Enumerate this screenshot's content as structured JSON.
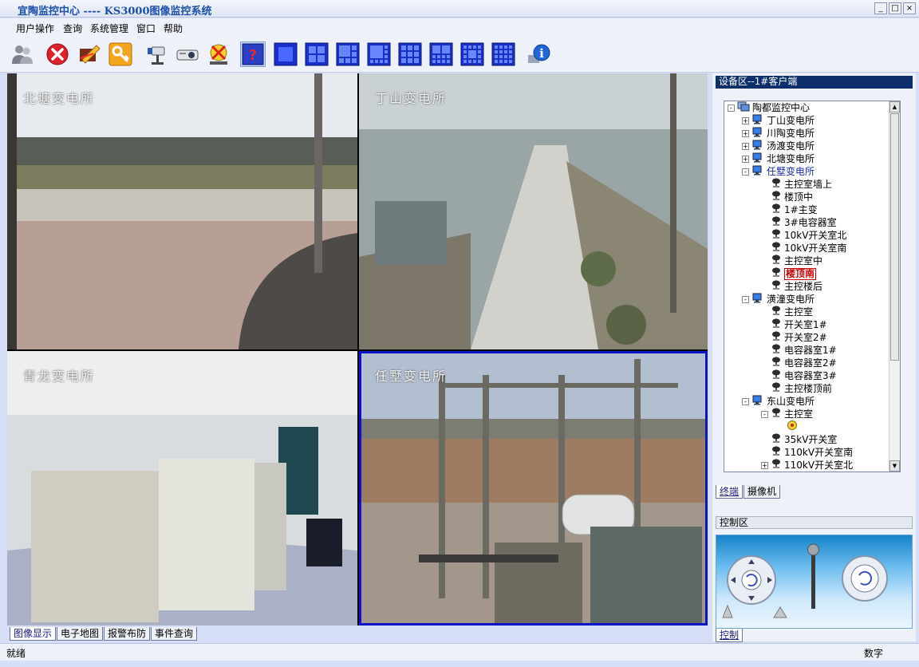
{
  "window": {
    "title": "宜陶监控中心 ---- KS3000图像监控系统",
    "btn_min": "_",
    "btn_max": "□",
    "btn_close": "×"
  },
  "menu": [
    "用户操作",
    "查询",
    "系统管理",
    "窗口",
    "帮助"
  ],
  "toolbar": {
    "icons": [
      "users-icon",
      "close-red-icon",
      "edit-icon",
      "key-icon",
      "camera-icon",
      "projector-icon",
      "disable-icon",
      "help-icon",
      "layout-1-icon",
      "layout-4-icon",
      "layout-6-icon",
      "layout-8-icon",
      "layout-9-icon",
      "layout-10-icon",
      "layout-13-icon",
      "layout-16-icon",
      "info-icon"
    ],
    "active_icon": "help-icon"
  },
  "video": {
    "panes": [
      {
        "label": "北塘变电所",
        "selected": false
      },
      {
        "label": "丁山变电所",
        "selected": false
      },
      {
        "label": "青龙变电所",
        "selected": false
      },
      {
        "label": "任墅变电所",
        "selected": true
      }
    ],
    "selected_border": "#0b15c7"
  },
  "bottom_tabs": [
    {
      "label": "图像显示",
      "active": true
    },
    {
      "label": "电子地图",
      "active": false
    },
    {
      "label": "报警布防",
      "active": false
    },
    {
      "label": "事件查询",
      "active": false
    }
  ],
  "status": {
    "left": "就绪",
    "right": "数字"
  },
  "device_panel": {
    "header": "设备区--1#客户端",
    "tree": [
      {
        "label": "陶都监控中心",
        "level": 0,
        "toggle": "-",
        "icon": "root"
      },
      {
        "label": "丁山变电所",
        "level": 1,
        "toggle": "+",
        "icon": "station"
      },
      {
        "label": "川陶变电所",
        "level": 1,
        "toggle": "+",
        "icon": "station"
      },
      {
        "label": "汤渡变电所",
        "level": 1,
        "toggle": "+",
        "icon": "station"
      },
      {
        "label": "北塘变电所",
        "level": 1,
        "toggle": "+",
        "icon": "station"
      },
      {
        "label": "任墅变电所",
        "level": 1,
        "toggle": "-",
        "icon": "station",
        "blue": true
      },
      {
        "label": "主控室墙上",
        "level": 2,
        "icon": "cam"
      },
      {
        "label": "楼顶中",
        "level": 2,
        "icon": "cam"
      },
      {
        "label": "1#主变",
        "level": 2,
        "icon": "cam"
      },
      {
        "label": "3#电容器室",
        "level": 2,
        "icon": "cam"
      },
      {
        "label": "10kV开关室北",
        "level": 2,
        "icon": "cam"
      },
      {
        "label": "10kV开关室南",
        "level": 2,
        "icon": "cam"
      },
      {
        "label": "主控室中",
        "level": 2,
        "icon": "cam"
      },
      {
        "label": "楼顶南",
        "level": 2,
        "icon": "cam",
        "highlight": true
      },
      {
        "label": "主控楼后",
        "level": 2,
        "icon": "cam"
      },
      {
        "label": "潢潼变电所",
        "level": 1,
        "toggle": "-",
        "icon": "station"
      },
      {
        "label": "主控室",
        "level": 2,
        "icon": "cam"
      },
      {
        "label": "开关室1#",
        "level": 2,
        "icon": "cam"
      },
      {
        "label": "开关室2#",
        "level": 2,
        "icon": "cam"
      },
      {
        "label": "电容器室1#",
        "level": 2,
        "icon": "cam"
      },
      {
        "label": "电容器室2#",
        "level": 2,
        "icon": "cam"
      },
      {
        "label": "电容器室3#",
        "level": 2,
        "icon": "cam"
      },
      {
        "label": "主控楼顶前",
        "level": 2,
        "icon": "cam"
      },
      {
        "label": "东山变电所",
        "level": 1,
        "toggle": "-",
        "icon": "station"
      },
      {
        "label": "主控室",
        "level": 2,
        "toggle": "-",
        "icon": "cam"
      },
      {
        "label": "",
        "level": 3,
        "icon": "alarm"
      },
      {
        "label": "35kV开关室",
        "level": 2,
        "icon": "cam"
      },
      {
        "label": "110kV开关室南",
        "level": 2,
        "icon": "cam"
      },
      {
        "label": "110kV开关室北",
        "level": 2,
        "toggle": "+",
        "icon": "cam"
      }
    ],
    "tabs": [
      {
        "label": "终端",
        "active": true
      },
      {
        "label": "摄像机",
        "active": false
      }
    ]
  },
  "control_panel": {
    "header": "控制区",
    "tab": "控制"
  }
}
